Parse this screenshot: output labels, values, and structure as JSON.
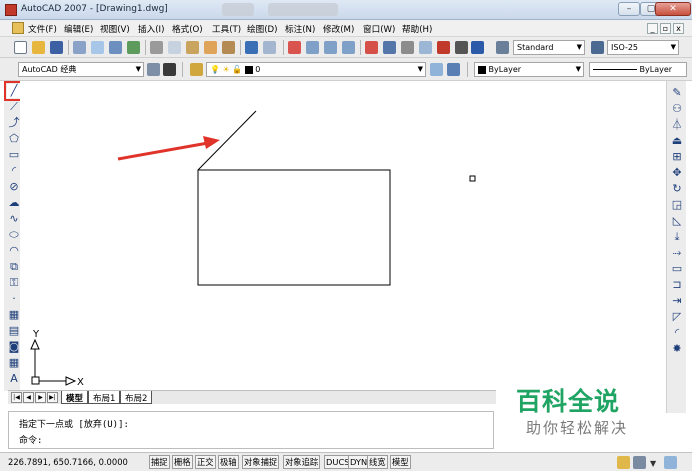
{
  "window": {
    "title": "AutoCAD 2007 - [Drawing1.dwg]",
    "controls": [
      "–",
      "▢",
      "✕"
    ]
  },
  "menu": {
    "items": [
      "文件(F)",
      "编辑(E)",
      "视图(V)",
      "插入(I)",
      "格式(O)",
      "工具(T)",
      "绘图(D)",
      "标注(N)",
      "修改(M)",
      "窗口(W)",
      "帮助(H)"
    ],
    "doc_controls": [
      "_",
      "▫",
      "x"
    ]
  },
  "toolbar": {
    "text_style": "Standard",
    "dim_style": "ISO-25",
    "workspace": "AutoCAD 经典",
    "layer": "0",
    "color": "ByLayer",
    "linetype": "ByLayer"
  },
  "left_tools": [
    {
      "icon": "line-icon",
      "glyph": "╱"
    },
    {
      "icon": "construction-line-icon",
      "glyph": "⟋"
    },
    {
      "icon": "polyline-icon",
      "glyph": "⤴"
    },
    {
      "icon": "polygon-icon",
      "glyph": "⬠"
    },
    {
      "icon": "rectangle-icon",
      "glyph": "▭"
    },
    {
      "icon": "arc-icon",
      "glyph": "◜"
    },
    {
      "icon": "circle-icon",
      "glyph": "⊘"
    },
    {
      "icon": "revision-cloud-icon",
      "glyph": "☁"
    },
    {
      "icon": "spline-icon",
      "glyph": "∿"
    },
    {
      "icon": "ellipse-icon",
      "glyph": "⬭"
    },
    {
      "icon": "ellipse-arc-icon",
      "glyph": "◠"
    },
    {
      "icon": "insert-block-icon",
      "glyph": "⧉"
    },
    {
      "icon": "make-block-icon",
      "glyph": "⚿"
    },
    {
      "icon": "point-icon",
      "glyph": "·"
    },
    {
      "icon": "hatch-icon",
      "glyph": "▦"
    },
    {
      "icon": "gradient-icon",
      "glyph": "▤"
    },
    {
      "icon": "region-icon",
      "glyph": "◙"
    },
    {
      "icon": "table-icon",
      "glyph": "▦"
    },
    {
      "icon": "multiline-text-icon",
      "glyph": "A"
    }
  ],
  "right_tools": [
    {
      "icon": "erase-icon",
      "glyph": "✎"
    },
    {
      "icon": "copy-icon",
      "glyph": "⚇"
    },
    {
      "icon": "mirror-icon",
      "glyph": "⏃"
    },
    {
      "icon": "offset-icon",
      "glyph": "⏏"
    },
    {
      "icon": "array-icon",
      "glyph": "⊞"
    },
    {
      "icon": "move-icon",
      "glyph": "✥"
    },
    {
      "icon": "rotate-icon",
      "glyph": "↻"
    },
    {
      "icon": "scale-icon",
      "glyph": "◲"
    },
    {
      "icon": "stretch-icon",
      "glyph": "◺"
    },
    {
      "icon": "trim-icon",
      "glyph": "⤓"
    },
    {
      "icon": "extend-icon",
      "glyph": "⤑"
    },
    {
      "icon": "break-at-point-icon",
      "glyph": "▭"
    },
    {
      "icon": "break-icon",
      "glyph": "⊐"
    },
    {
      "icon": "join-icon",
      "glyph": "⇥"
    },
    {
      "icon": "chamfer-icon",
      "glyph": "◸"
    },
    {
      "icon": "fillet-icon",
      "glyph": "◜"
    },
    {
      "icon": "explode-icon",
      "glyph": "✸"
    }
  ],
  "ucs": {
    "x_label": "X",
    "y_label": "Y"
  },
  "layout_tabs": [
    "模型",
    "布局1",
    "布局2"
  ],
  "command": {
    "line1": "指定下一点或 [放弃(U)]:",
    "line2": "命令:"
  },
  "status": {
    "coords": "226.7891, 650.7166, 0.0000",
    "toggles": [
      "捕捉",
      "栅格",
      "正交",
      "极轴",
      "对象捕捉",
      "对象追踪",
      "DUCS",
      "DYN",
      "线宽",
      "模型"
    ]
  },
  "watermark": {
    "title": "百科全说",
    "subtitle": "助你轻松解决"
  },
  "colors": {
    "highlight": "#e0342b",
    "arrow": "#e0342b",
    "watermark": "#1fa463"
  }
}
